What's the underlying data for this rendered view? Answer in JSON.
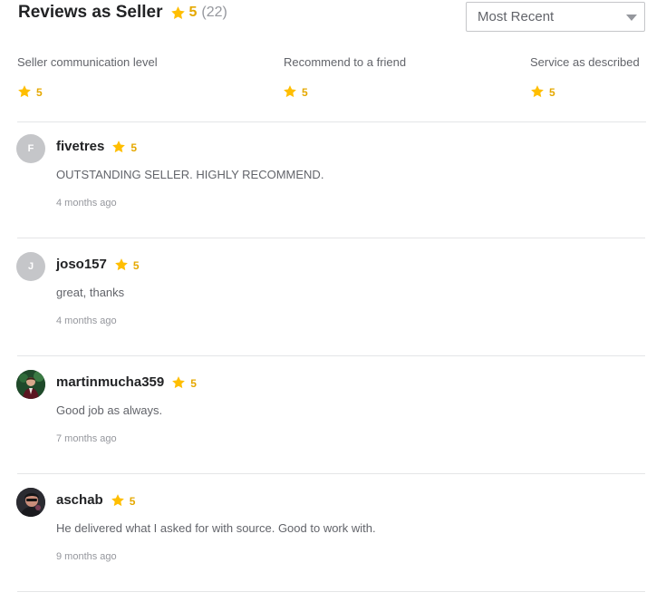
{
  "header": {
    "title": "Reviews as Seller",
    "score": "5",
    "count": "(22)"
  },
  "sort": {
    "selected": "Most Recent"
  },
  "breakdown": [
    {
      "label": "Seller communication level",
      "rating": "5"
    },
    {
      "label": "Recommend to a friend",
      "rating": "5"
    },
    {
      "label": "Service as described",
      "rating": "5"
    }
  ],
  "reviews": [
    {
      "initial": "F",
      "username": "fivetres",
      "rating": "5",
      "comment": "OUTSTANDING SELLER. HIGHLY RECOMMEND.",
      "time": "4 months ago"
    },
    {
      "initial": "J",
      "username": "joso157",
      "rating": "5",
      "comment": "great, thanks",
      "time": "4 months ago"
    },
    {
      "initial": "",
      "username": "martinmucha359",
      "rating": "5",
      "comment": "Good job as always.",
      "time": "7 months ago"
    },
    {
      "initial": "",
      "username": "aschab",
      "rating": "5",
      "comment": "He delivered what I asked for with source. Good to work with.",
      "time": "9 months ago"
    }
  ],
  "colors": {
    "star": "#ffbe00",
    "rating_text": "#e5a800",
    "divider": "#e4e5e7",
    "avatar_placeholder": "#c5c6c9"
  },
  "icons": {
    "rating": "star-icon",
    "sort": "chevron-down-icon"
  }
}
